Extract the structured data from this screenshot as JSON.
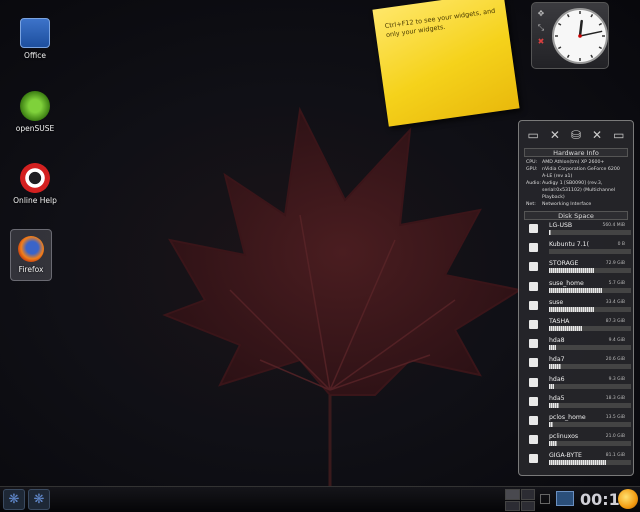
{
  "desktop": {
    "icons": [
      {
        "label": "Office",
        "icon": "folder-icon"
      },
      {
        "label": "openSUSE",
        "icon": "opensuse-icon"
      },
      {
        "label": "Online Help",
        "icon": "lifebuoy-icon"
      },
      {
        "label": "Firefox",
        "icon": "firefox-icon"
      }
    ]
  },
  "note": {
    "text": "Ctrl+F12 to see your widgets, and only your widgets."
  },
  "clock": {
    "time": "00:13",
    "handle_icons": [
      "move-icon",
      "resize-icon",
      "close-icon"
    ]
  },
  "hardware": {
    "top_icons": [
      "harddisk-icon",
      "close-icon",
      "network-icon",
      "close-icon",
      "harddisk-icon"
    ],
    "info_title": "Hardware Info",
    "info": [
      {
        "key": "CPU:",
        "value": "AMD Athlon(tm) XP 2600+"
      },
      {
        "key": "GPU:",
        "value": "nVidia Corporation GeForce 6200 A-LE (rev a1)"
      },
      {
        "key": "Audio:",
        "value": "Audigy 1 [SB0090] (rev.3, serial:0x531102) (Multichannel Playback)"
      },
      {
        "key": "Net:",
        "value": "Networking Interface"
      }
    ],
    "disk_title": "Disk Space",
    "disks": [
      {
        "name": "LG-USB",
        "size": "560.4 MiB",
        "usage": 0.02
      },
      {
        "name": "Kubuntu 7.1(",
        "size": "0 B",
        "usage": 0.0
      },
      {
        "name": "STORAGE",
        "size": "72.9 GiB",
        "usage": 0.55
      },
      {
        "name": "suse_home",
        "size": "5.7 GiB",
        "usage": 0.65
      },
      {
        "name": "suse",
        "size": "33.4 GiB",
        "usage": 0.55
      },
      {
        "name": "TASHA",
        "size": "87.3 GiB",
        "usage": 0.4
      },
      {
        "name": "hda8",
        "size": "9.4 GiB",
        "usage": 0.08
      },
      {
        "name": "hda7",
        "size": "20.6 GiB",
        "usage": 0.15
      },
      {
        "name": "hda6",
        "size": "9.3 GiB",
        "usage": 0.06
      },
      {
        "name": "hda5",
        "size": "18.3 GiB",
        "usage": 0.12
      },
      {
        "name": "pclos_home",
        "size": "13.5 GiB",
        "usage": 0.05
      },
      {
        "name": "pclinuxos",
        "size": "21.0 GiB",
        "usage": 0.1
      },
      {
        "name": "GIGA-BYTE",
        "size": "81.1 GiB",
        "usage": 0.7
      }
    ]
  },
  "taskbar": {
    "clock": "00:13"
  },
  "colors": {
    "note": "#f5d21b",
    "panel": "#262629",
    "accent": "#5f86c8"
  }
}
